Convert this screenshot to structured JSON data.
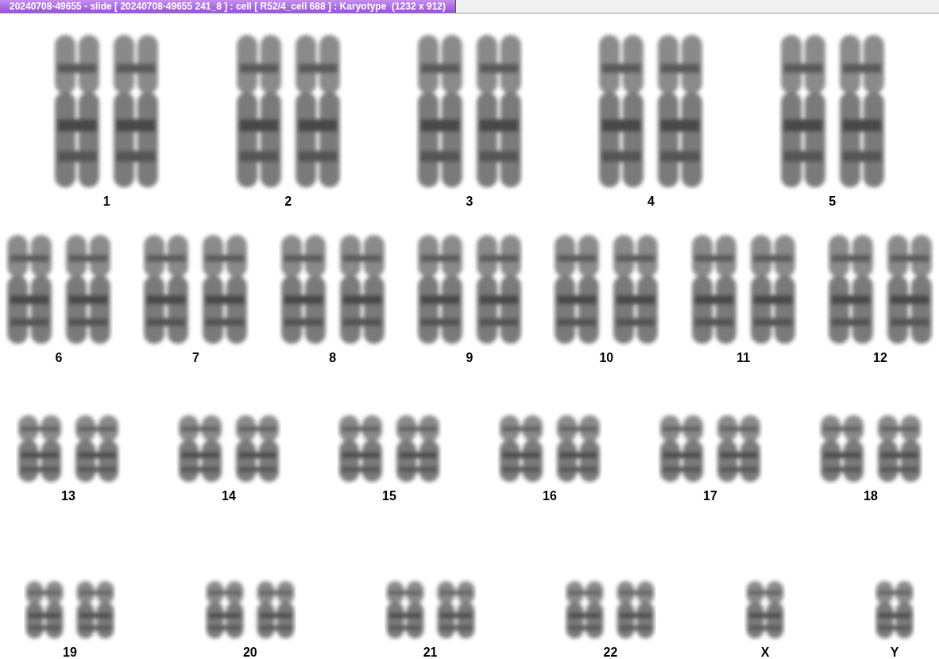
{
  "window": {
    "title": "20240708-49655 - slide [ 20240708-49655 241_8 ] : cell [ R52/4_cell 688 ] : Karyotype  (1232 x 912)"
  },
  "rows": [
    {
      "items": [
        {
          "label": "1",
          "kind": "pair"
        },
        {
          "label": "2",
          "kind": "pair"
        },
        {
          "label": "3",
          "kind": "pair"
        },
        {
          "label": "4",
          "kind": "pair"
        },
        {
          "label": "5",
          "kind": "pair"
        }
      ]
    },
    {
      "items": [
        {
          "label": "6",
          "kind": "pair"
        },
        {
          "label": "7",
          "kind": "pair"
        },
        {
          "label": "8",
          "kind": "pair"
        },
        {
          "label": "9",
          "kind": "pair"
        },
        {
          "label": "10",
          "kind": "pair"
        },
        {
          "label": "11",
          "kind": "pair"
        },
        {
          "label": "12",
          "kind": "pair"
        }
      ]
    },
    {
      "items": [
        {
          "label": "13",
          "kind": "pair"
        },
        {
          "label": "14",
          "kind": "pair"
        },
        {
          "label": "15",
          "kind": "pair"
        },
        {
          "label": "16",
          "kind": "pair"
        },
        {
          "label": "17",
          "kind": "pair"
        },
        {
          "label": "18",
          "kind": "pair"
        }
      ]
    },
    {
      "items": [
        {
          "label": "19",
          "kind": "pair"
        },
        {
          "label": "20",
          "kind": "pair"
        },
        {
          "label": "21",
          "kind": "pair"
        },
        {
          "label": "22",
          "kind": "pair"
        },
        {
          "label": "X",
          "kind": "single"
        },
        {
          "label": "Y",
          "kind": "single"
        }
      ]
    }
  ]
}
